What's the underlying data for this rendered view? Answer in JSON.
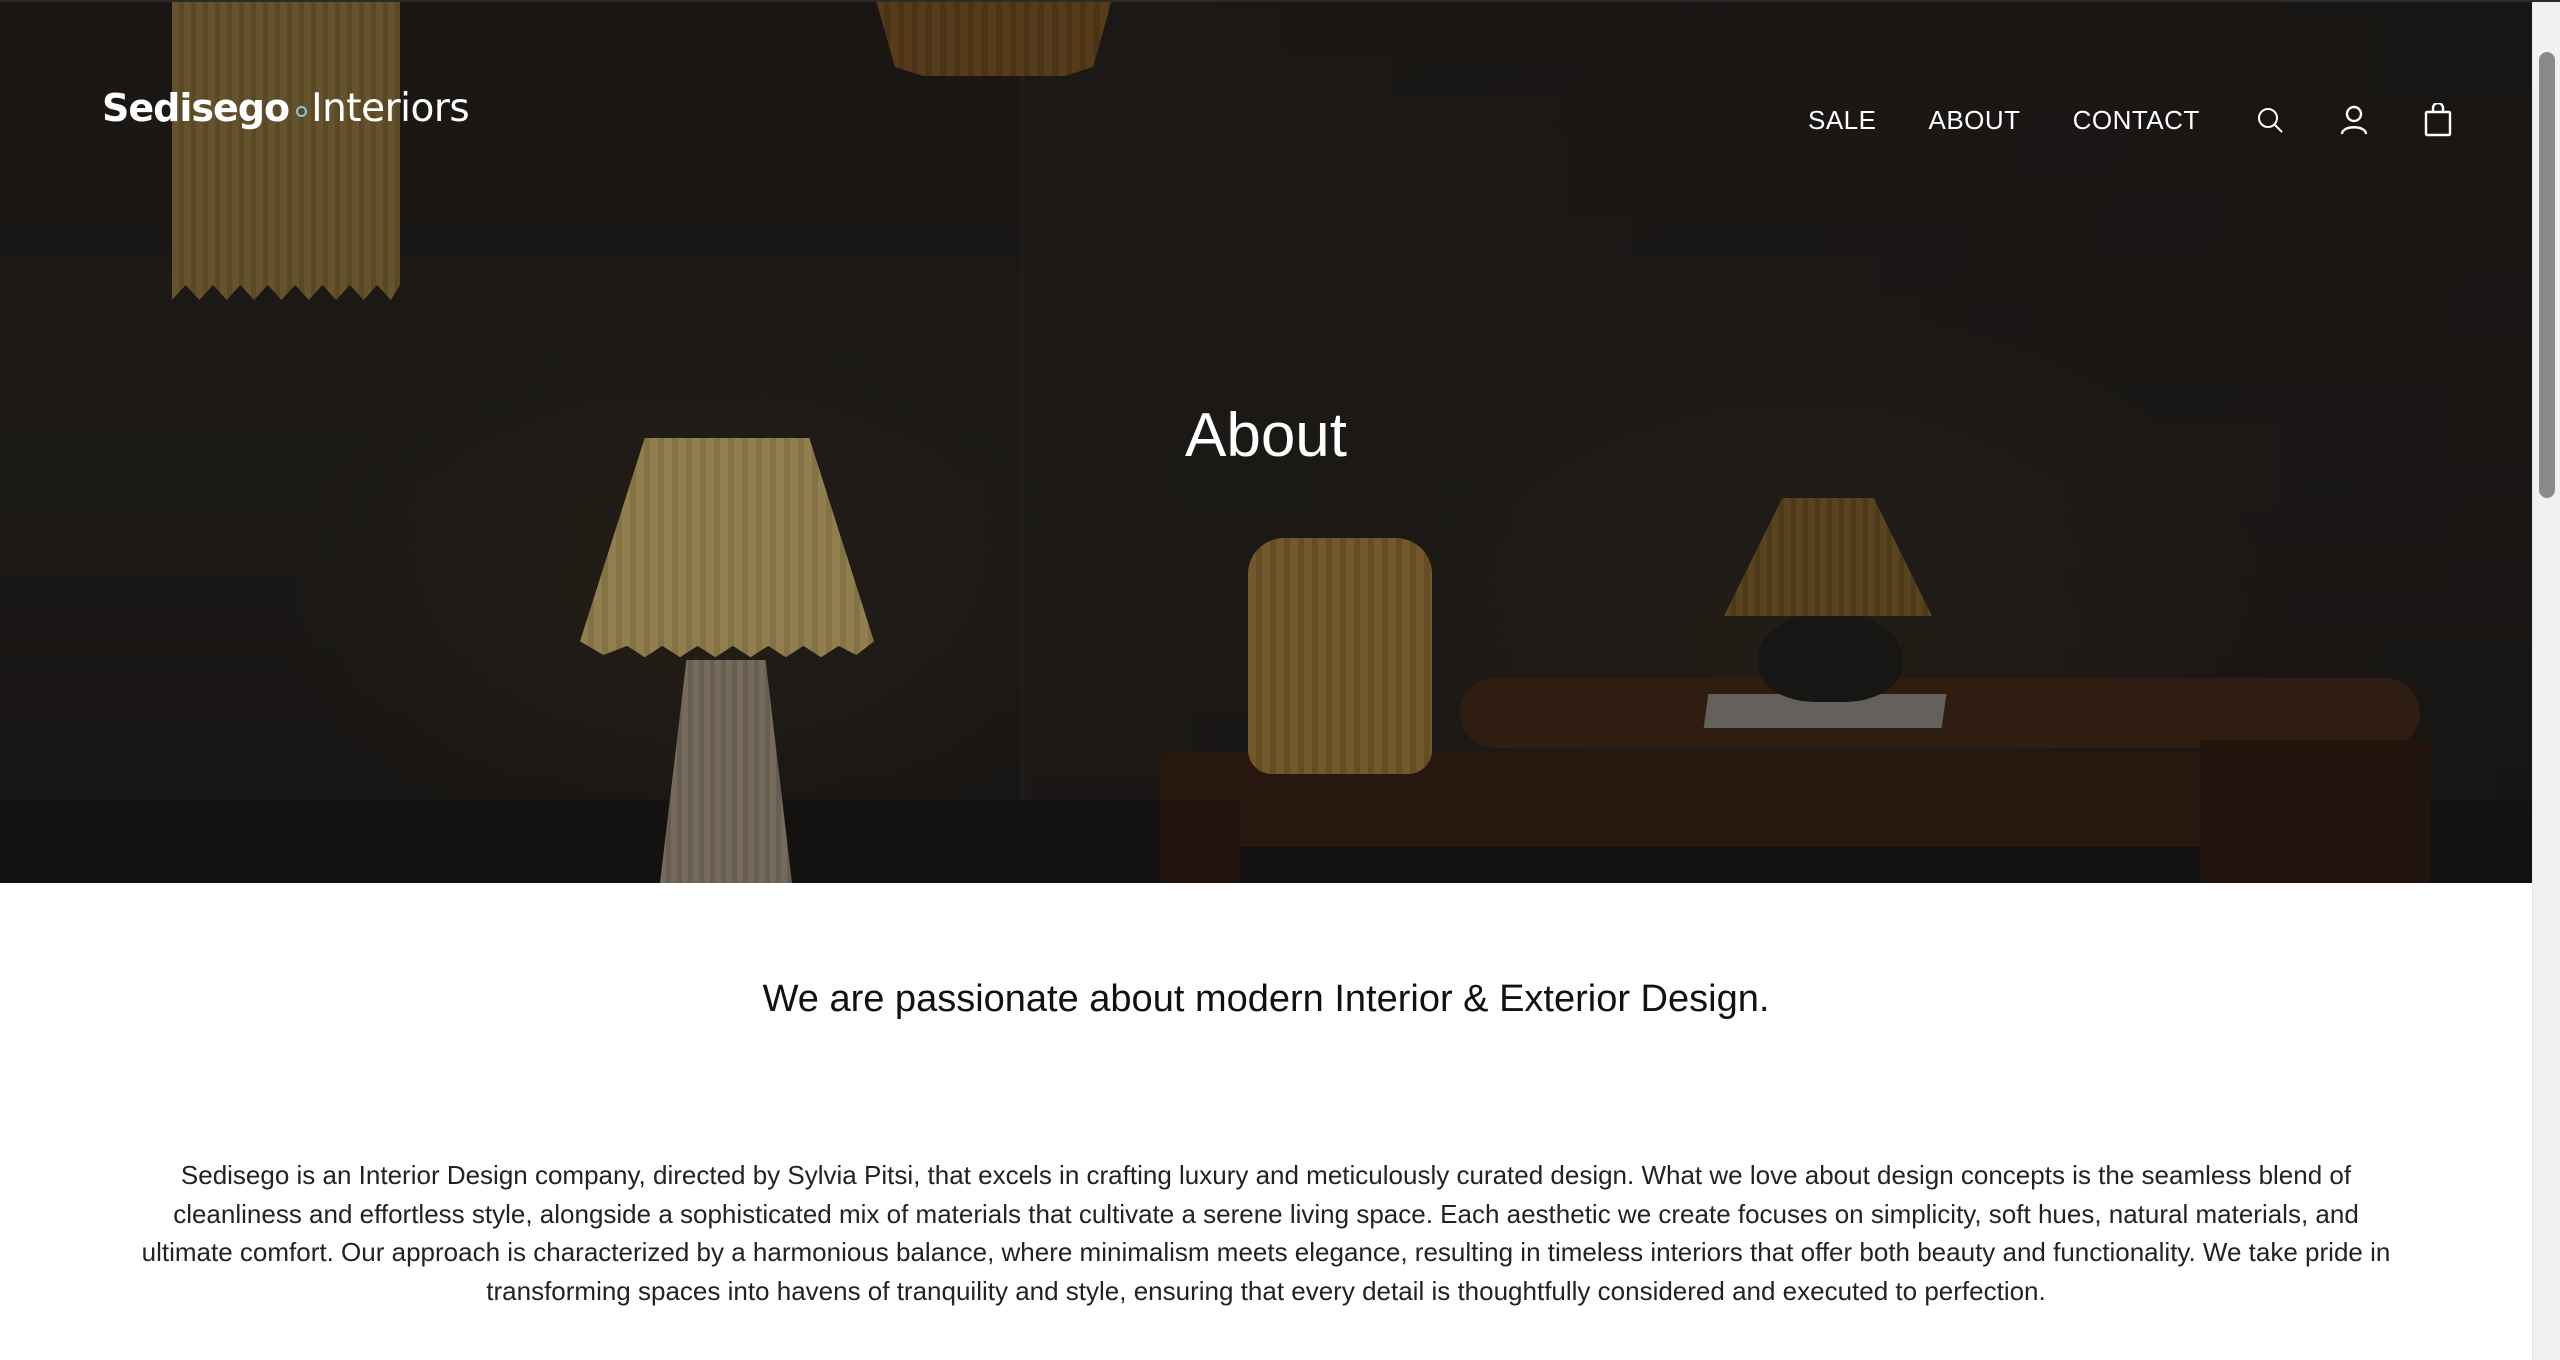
{
  "header": {
    "logo_primary": "Sedisego",
    "logo_secondary": "Interiors",
    "nav": {
      "sale": "SALE",
      "about": "ABOUT",
      "contact": "CONTACT"
    },
    "icons": [
      "search-icon",
      "account-icon",
      "shopping-bag-icon"
    ]
  },
  "hero": {
    "title": "About"
  },
  "content": {
    "tagline": "We are passionate about modern Interior & Exterior Design.",
    "body": "Sedisego is an Interior Design company, directed by Sylvia Pitsi, that excels in crafting luxury and meticulously curated design. What we love about design concepts is the seamless blend of cleanliness and effortless style, alongside a sophisticated mix of materials that cultivate a serene living space. Each aesthetic we create focuses on simplicity, soft hues, natural materials, and ultimate comfort. Our approach is characterized by a harmonious balance, where minimalism meets elegance, resulting in timeless interiors that offer both beauty and functionality. We take pride in transforming spaces into havens of tranquility and style, ensuring that every detail is thoughtfully considered and executed to perfection."
  },
  "colors": {
    "logo_dot_accent": "#7fc8dc",
    "hero_overlay": "#1f1c19",
    "text_dark": "#111111"
  }
}
